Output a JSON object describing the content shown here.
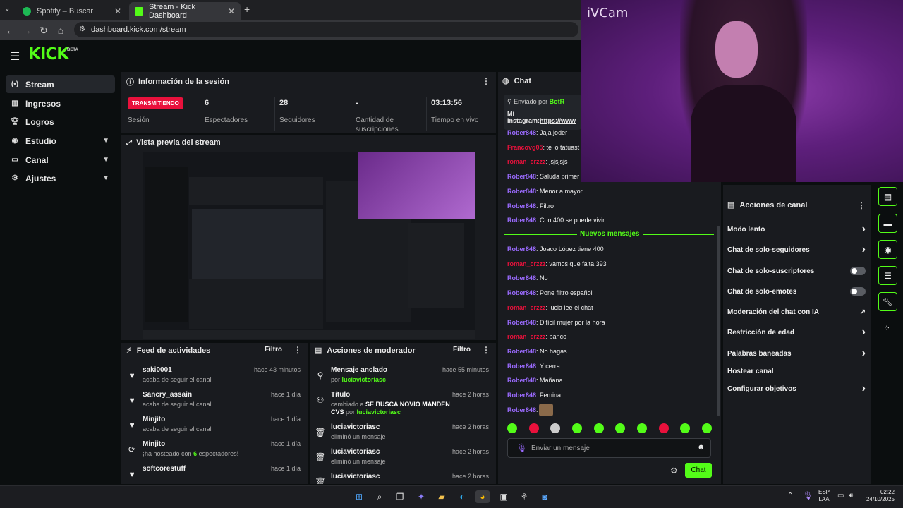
{
  "browser": {
    "tabs": [
      {
        "title": "Spotify – Buscar"
      },
      {
        "title": "Stream - Kick Dashboard"
      }
    ],
    "url": "dashboard.kick.com/stream"
  },
  "brand": {
    "logo": "KICK",
    "beta": "BETA",
    "accent": "#53fc18"
  },
  "sidebar": {
    "items": [
      {
        "label": "Stream",
        "icon": "broadcast-icon"
      },
      {
        "label": "Ingresos",
        "icon": "chart-icon"
      },
      {
        "label": "Logros",
        "icon": "trophy-icon"
      },
      {
        "label": "Estudio",
        "icon": "palette-icon"
      },
      {
        "label": "Canal",
        "icon": "screen-icon"
      },
      {
        "label": "Ajustes",
        "icon": "gear-icon"
      }
    ]
  },
  "session": {
    "title": "Información de la sesión",
    "badge": "TRANSMITIENDO",
    "badge_label": "Sesión",
    "stats": [
      {
        "value": "6",
        "label": "Espectadores"
      },
      {
        "value": "28",
        "label": "Seguidores"
      },
      {
        "value": "-",
        "label": "Cantidad de suscripciones"
      },
      {
        "value": "03:13:56",
        "label": "Tiempo en vivo"
      }
    ]
  },
  "preview": {
    "title": "Vista previa del stream"
  },
  "feed": {
    "title": "Feed de actividades",
    "filter": "Filtro",
    "items": [
      {
        "name": "saki0001",
        "sub": "acaba de seguir el canal",
        "time": "hace 43 minutos",
        "icon": "heart-icon"
      },
      {
        "name": "Sancry_assain",
        "sub": "acaba de seguir el canal",
        "time": "hace 1 día",
        "icon": "heart-icon"
      },
      {
        "name": "Minjito",
        "sub": "acaba de seguir el canal",
        "time": "hace 1 día",
        "icon": "heart-icon"
      },
      {
        "name": "Minjito",
        "sub_pre": "¡ha hosteado con ",
        "sub_num": "6",
        "sub_post": " espectadores!",
        "time": "hace 1 día",
        "icon": "host-icon"
      },
      {
        "name": "softcorestuff",
        "sub": "",
        "time": "hace 1 día",
        "icon": "heart-icon"
      }
    ]
  },
  "modactions": {
    "title": "Acciones de moderador",
    "filter": "Filtro",
    "items": [
      {
        "name": "Mensaje anclado",
        "sub_pre": "por ",
        "sub_user": "luciavictoriasc",
        "time": "hace 55 minutos",
        "icon": "pin-icon"
      },
      {
        "name": "Título",
        "sub_pre": "cambiado a ",
        "sub_bold": "SE BUSCA NOVIO MANDEN CVS",
        "sub_mid": " por ",
        "sub_user": "luciavictoriasc",
        "time": "hace 2 horas",
        "icon": "user-edit-icon"
      },
      {
        "name": "luciavictoriasc",
        "sub": "eliminó un mensaje",
        "time": "hace 2 horas",
        "icon": "trash-icon"
      },
      {
        "name": "luciavictoriasc",
        "sub": "eliminó un mensaje",
        "time": "hace 2 horas",
        "icon": "trash-icon"
      },
      {
        "name": "luciavictoriasc",
        "sub": "",
        "time": "hace 2 horas",
        "icon": "trash-icon"
      }
    ]
  },
  "chat": {
    "title": "Chat",
    "pinned": {
      "label": "Enviado por",
      "user": "BotR",
      "text": "Mi",
      "text2": "Instagram:",
      "link": "https://www"
    },
    "messages": [
      {
        "user": "Rober848",
        "text": "Jaja joder",
        "c": "p"
      },
      {
        "user": "Francovg05",
        "text": "te lo tatuast",
        "c": "r"
      },
      {
        "user": "roman_crzzz",
        "text": "jsjsjsjs",
        "c": "r"
      },
      {
        "user": "Rober848",
        "text": "Saluda primer",
        "c": "p"
      },
      {
        "user": "Rober848",
        "text": "Menor a mayor",
        "c": "p"
      },
      {
        "user": "Rober848",
        "text": "Filtro",
        "c": "p"
      },
      {
        "user": "Rober848",
        "text": "Con 400 se puede vivir",
        "c": "p"
      }
    ],
    "new_label": "Nuevos mensajes",
    "new_messages": [
      {
        "user": "Rober848",
        "text": "Joaco López tiene 400",
        "c": "p"
      },
      {
        "user": "roman_crzzz",
        "text": "vamos que falta 393",
        "c": "r"
      },
      {
        "user": "Rober848",
        "text": "No",
        "c": "p"
      },
      {
        "user": "Rober848",
        "text": "Pone filtro español",
        "c": "p"
      },
      {
        "user": "roman_crzzz",
        "text": "lucia lee el chat",
        "c": "r"
      },
      {
        "user": "Rober848",
        "text": "Difícil mujer por la hora",
        "c": "p"
      },
      {
        "user": "roman_crzzz",
        "text": "banco",
        "c": "r"
      },
      {
        "user": "Rober848",
        "text": "No hagas",
        "c": "p"
      },
      {
        "user": "Rober848",
        "text": "Y cerra",
        "c": "p"
      },
      {
        "user": "Rober848",
        "text": "Mañana",
        "c": "p"
      },
      {
        "user": "Rober848",
        "text": "Femina",
        "c": "p"
      },
      {
        "user": "Rober848",
        "text": "",
        "c": "p"
      }
    ],
    "input_placeholder": "Enviar un mensaje",
    "send": "Chat"
  },
  "webcam": {
    "label": "iVCam"
  },
  "channel_actions": {
    "title": "Acciones de canal",
    "items": [
      {
        "label": "Modo lento",
        "ctrl": "chevron"
      },
      {
        "label": "Chat de solo-seguidores",
        "ctrl": "chevron"
      },
      {
        "label": "Chat de solo-suscriptores",
        "ctrl": "toggle"
      },
      {
        "label": "Chat de solo-emotes",
        "ctrl": "toggle"
      },
      {
        "label": "Moderación del chat con IA",
        "ctrl": "external"
      },
      {
        "label": "Restricción de edad",
        "ctrl": "chevron"
      },
      {
        "label": "Palabras baneadas",
        "ctrl": "chevron"
      },
      {
        "label": "Hostear canal",
        "ctrl": "none"
      },
      {
        "label": "Configurar objetivos",
        "ctrl": "chevron"
      }
    ]
  },
  "taskbar": {
    "lang1": "ESP",
    "lang2": "LAA",
    "time": "02:22",
    "date": "24/10/2025"
  }
}
